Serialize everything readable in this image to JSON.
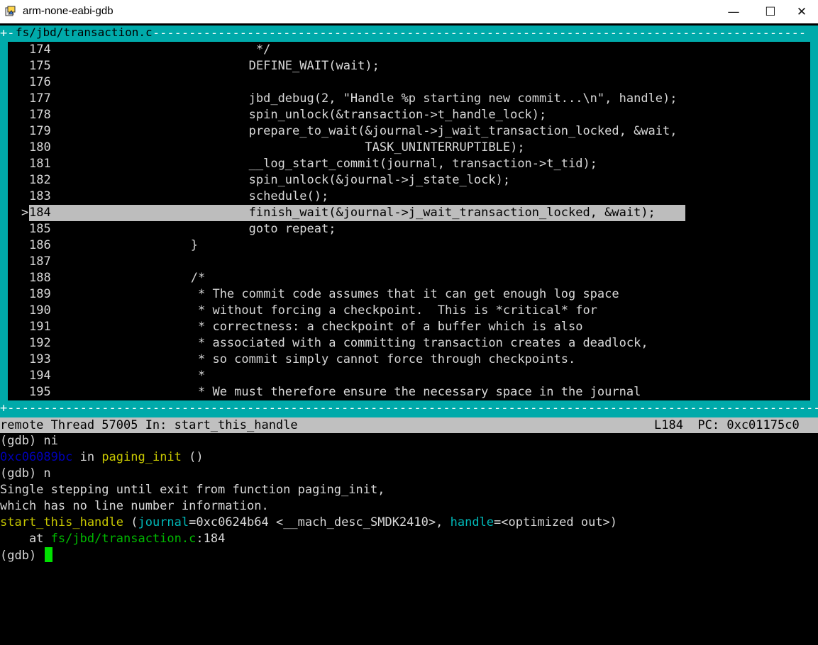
{
  "window": {
    "title": "arm-none-eabi-gdb",
    "icon": "gdb-app-icon",
    "controls": {
      "minimize": "—",
      "maximize": "☐",
      "close": "✕"
    }
  },
  "source": {
    "frame_prefix": "+-",
    "filename": "fs/jbd/transaction.c",
    "marker": ">",
    "lines": [
      {
        "num": "174",
        "text": "                         */"
      },
      {
        "num": "175",
        "text": "                        DEFINE_WAIT(wait);"
      },
      {
        "num": "176",
        "text": ""
      },
      {
        "num": "177",
        "text": "                        jbd_debug(2, \"Handle %p starting new commit...\\n\", handle);"
      },
      {
        "num": "178",
        "text": "                        spin_unlock(&transaction->t_handle_lock);"
      },
      {
        "num": "179",
        "text": "                        prepare_to_wait(&journal->j_wait_transaction_locked, &wait,"
      },
      {
        "num": "180",
        "text": "                                        TASK_UNINTERRUPTIBLE);"
      },
      {
        "num": "181",
        "text": "                        __log_start_commit(journal, transaction->t_tid);"
      },
      {
        "num": "182",
        "text": "                        spin_unlock(&journal->j_state_lock);"
      },
      {
        "num": "183",
        "text": "                        schedule();"
      },
      {
        "num": "184",
        "text": "                        finish_wait(&journal->j_wait_transaction_locked, &wait);",
        "current": true
      },
      {
        "num": "185",
        "text": "                        goto repeat;"
      },
      {
        "num": "186",
        "text": "                }"
      },
      {
        "num": "187",
        "text": ""
      },
      {
        "num": "188",
        "text": "                /*"
      },
      {
        "num": "189",
        "text": "                 * The commit code assumes that it can get enough log space"
      },
      {
        "num": "190",
        "text": "                 * without forcing a checkpoint.  This is *critical* for"
      },
      {
        "num": "191",
        "text": "                 * correctness: a checkpoint of a buffer which is also"
      },
      {
        "num": "192",
        "text": "                 * associated with a committing transaction creates a deadlock,"
      },
      {
        "num": "193",
        "text": "                 * so commit simply cannot force through checkpoints."
      },
      {
        "num": "194",
        "text": "                 *"
      },
      {
        "num": "195",
        "text": "                 * We must therefore ensure the necessary space in the journal"
      }
    ]
  },
  "status": {
    "left": "remote Thread 57005 In: start_this_handle",
    "right": "L184  PC: 0xc01175c0"
  },
  "console": {
    "l1": {
      "prompt": "(gdb) ",
      "cmd": "ni"
    },
    "l2": {
      "addr": "0xc06089bc",
      "in": " in ",
      "func": "paging_init",
      "rest": " ()"
    },
    "l3": {
      "prompt": "(gdb) ",
      "cmd": "n"
    },
    "l4": "Single stepping until exit from function paging_init,",
    "l5": "which has no line number information.",
    "l6": {
      "func": "start_this_handle",
      "p1": " (",
      "arg1": "journal",
      "v1": "=0xc0624b64 <__mach_desc_SMDK2410>, ",
      "arg2": "handle",
      "v2": "=<optimized out>)"
    },
    "l7": {
      "at": "    at ",
      "file": "fs/jbd/transaction.c",
      "line": ":184"
    },
    "l8": {
      "prompt": "(gdb) "
    }
  }
}
